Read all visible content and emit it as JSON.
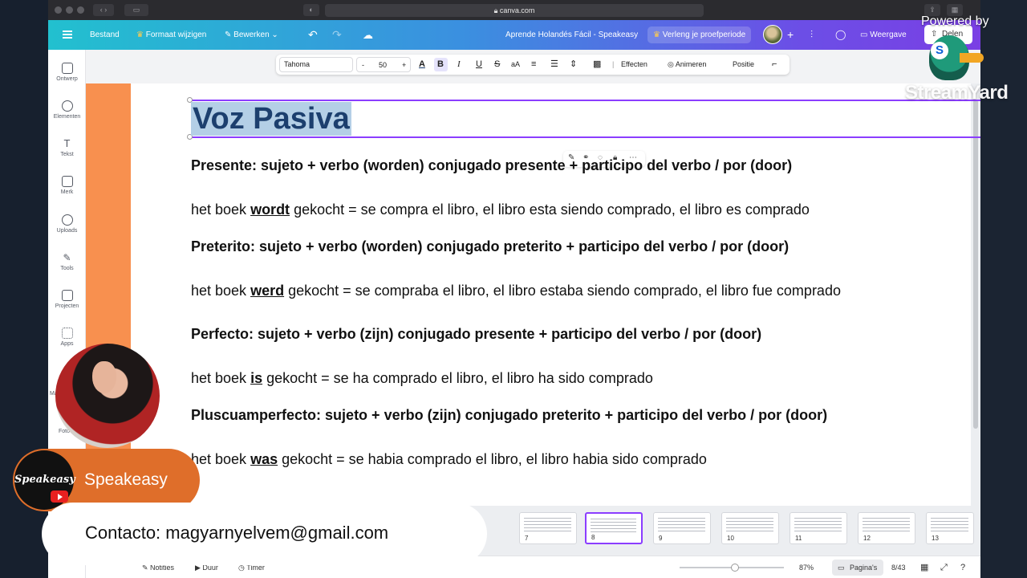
{
  "browser": {
    "url": "canva.com"
  },
  "topbar": {
    "file": "Bestand",
    "resize": "Formaat wijzigen",
    "edit": "Bewerken",
    "doc_title": "Aprende Holandés Fácil - Speakeasy",
    "trial": "Verleng je proefperiode",
    "view": "Weergave",
    "share": "Delen"
  },
  "sidebar": {
    "items": [
      {
        "label": "Ontwerp"
      },
      {
        "label": "Elementen"
      },
      {
        "label": "Tekst"
      },
      {
        "label": "Merk"
      },
      {
        "label": "Uploads"
      },
      {
        "label": "Tools"
      },
      {
        "label": "Projecten"
      },
      {
        "label": "Apps"
      },
      {
        "label": "Ma"
      },
      {
        "label": "Foto"
      }
    ]
  },
  "toolbar": {
    "font": "Tahoma",
    "minus": "-",
    "size": "50",
    "plus": "+",
    "effects": "Effecten",
    "animate": "Animeren",
    "position": "Positie"
  },
  "slide": {
    "title": "Voz Pasiva",
    "lines": [
      {
        "bold": "Presente: sujeto + verbo (worden) conjugado presente + participo del verbo / por (door)"
      },
      {
        "pre": "het boek ",
        "u": "wordt",
        "post": " gekocht = se compra el libro, el libro esta siendo comprado, el libro es comprado"
      },
      {
        "bold": "Preterito: sujeto + verbo (worden) conjugado preterito + participo del verbo / por (door)"
      },
      {
        "pre": "het boek ",
        "u": "werd",
        "post": " gekocht = se compraba el libro, el libro estaba siendo comprado, el libro fue comprado"
      },
      {
        "bold": "Perfecto: sujeto + verbo (zijn) conjugado presente + participo del verbo / por (door)"
      },
      {
        "pre": "het boek ",
        "u": "is",
        "post": " gekocht = se ha comprado el libro, el libro ha sido comprado"
      },
      {
        "bold": "Pluscuamperfecto: sujeto + verbo (zijn) conjugado preterito + participo del verbo / por (door)"
      },
      {
        "pre": "het boek ",
        "u": "was",
        "post": " gekocht = se habia comprado el libro, el libro habia sido comprado"
      }
    ]
  },
  "thumbnails": [
    {
      "num": "7"
    },
    {
      "num": "8"
    },
    {
      "num": "9"
    },
    {
      "num": "10"
    },
    {
      "num": "11"
    },
    {
      "num": "12"
    },
    {
      "num": "13"
    }
  ],
  "bottombar": {
    "notes": "Notities",
    "duration": "Duur",
    "timer": "Timer",
    "zoom": "87%",
    "pages": "Pagina's",
    "page_count": "8/43"
  },
  "overlay": {
    "channel": "Speakeasy",
    "logo_text": "Speakeasy",
    "contact": "Contacto: magyarnyelvem@gmail.com",
    "powered_by": "Powered by",
    "streamyard": "StreamYard"
  }
}
